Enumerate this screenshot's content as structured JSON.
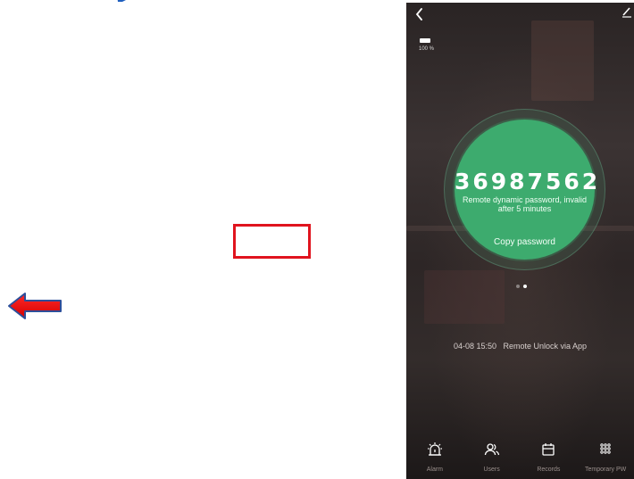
{
  "colors": {
    "accent_green": "#3dab6e",
    "annotation_red": "#e0141e",
    "fragment_blue": "#1f5fbf"
  },
  "lock": {
    "battery_level": "100 %",
    "password": "36987562",
    "password_hint": "Remote dynamic password, invalid after 5 minutes",
    "copy_label": "Copy password",
    "pager": {
      "count": 2,
      "active": 1
    },
    "last_record": {
      "time": "04-08 15:50",
      "text": "Remote Unlock via App"
    }
  },
  "nav": [
    {
      "label": "Alarm",
      "icon": "alarm-icon"
    },
    {
      "label": "Users",
      "icon": "users-icon"
    },
    {
      "label": "Records",
      "icon": "calendar-icon"
    },
    {
      "label": "Temporary PW",
      "icon": "keypad-icon"
    }
  ],
  "annotations": {
    "box": "red-rectangle-annotation",
    "arrow": "red-left-arrow-annotation"
  }
}
